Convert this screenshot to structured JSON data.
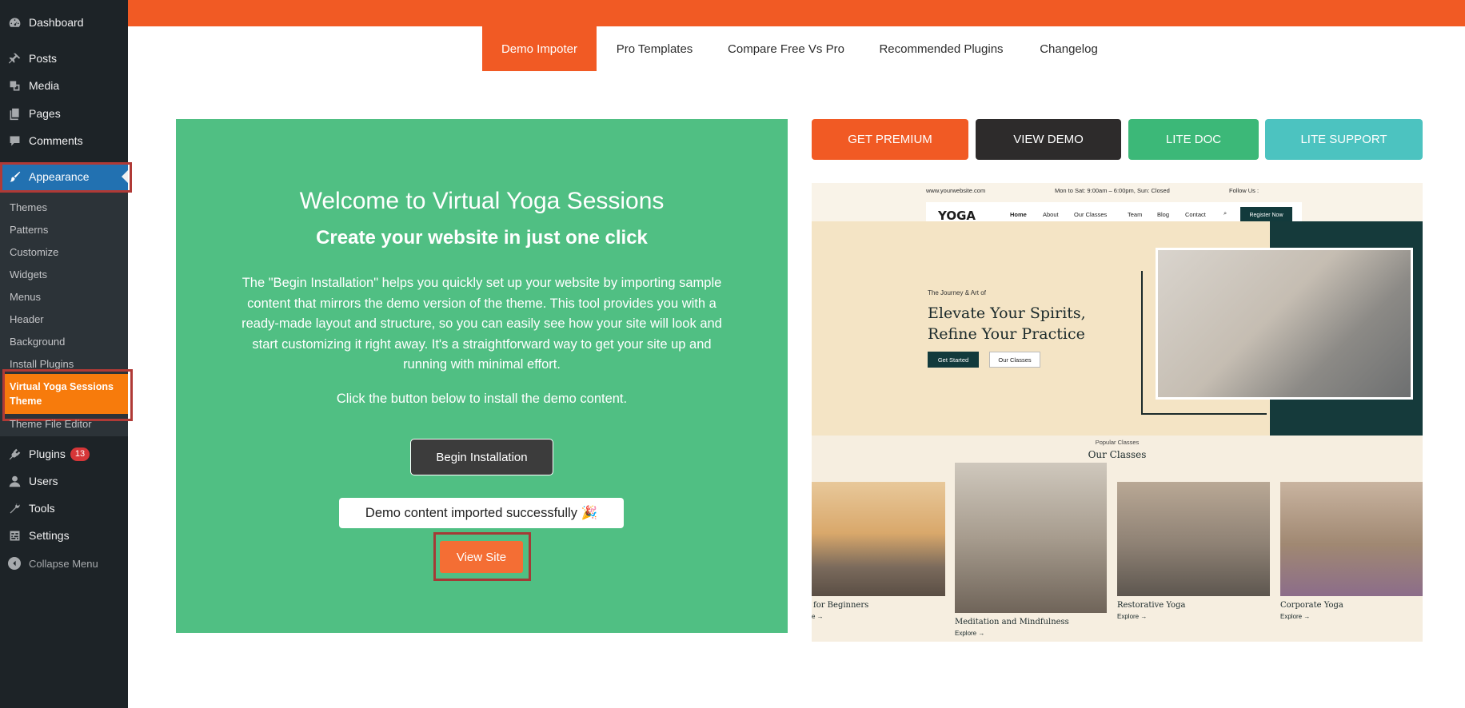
{
  "sidebar": {
    "items": [
      {
        "label": "Dashboard",
        "icon": "dashboard-icon"
      },
      {
        "label": "Posts",
        "icon": "pin-icon"
      },
      {
        "label": "Media",
        "icon": "media-icon"
      },
      {
        "label": "Pages",
        "icon": "pages-icon"
      },
      {
        "label": "Comments",
        "icon": "comment-icon"
      },
      {
        "label": "Appearance",
        "icon": "brush-icon"
      },
      {
        "label": "Plugins",
        "icon": "plugin-icon",
        "badge": "13"
      },
      {
        "label": "Users",
        "icon": "user-icon"
      },
      {
        "label": "Tools",
        "icon": "wrench-icon"
      },
      {
        "label": "Settings",
        "icon": "settings-icon"
      }
    ],
    "submenu": [
      "Themes",
      "Patterns",
      "Customize",
      "Widgets",
      "Menus",
      "Header",
      "Background",
      "Install Plugins",
      "Virtual Yoga Sessions Theme",
      "Theme File Editor"
    ],
    "collapse_label": "Collapse Menu"
  },
  "tabs": [
    "Demo Impoter",
    "Pro Templates",
    "Compare Free Vs Pro",
    "Recommended Plugins",
    "Changelog"
  ],
  "card": {
    "welcome": "Welcome to Virtual Yoga Sessions",
    "headline": "Create your website in just one click",
    "description": "The \"Begin Installation\" helps you quickly set up your website by importing sample content that mirrors the demo version of the theme. This tool provides you with a ready-made layout and structure, so you can easily see how your site will look and start customizing it right away. It's a straightforward way to get your site up and running with minimal effort.",
    "click_note": "Click the button below to install the demo content.",
    "begin_label": "Begin Installation",
    "success_msg": "Demo content imported successfully 🎉",
    "view_site_label": "View Site"
  },
  "actions": [
    "GET PREMIUM",
    "VIEW DEMO",
    "LITE DOC",
    "LITE SUPPORT"
  ],
  "colors": {
    "accent_orange": "#f15a24",
    "green": "#50bf83",
    "dark": "#2d2d2d",
    "doc_green": "#3cb878",
    "support_teal": "#4cc3c0",
    "wp_blue": "#2271b1",
    "highlight_red": "#b03a36"
  },
  "preview": {
    "site_url": "www.yourwebsite.com",
    "hours": "Mon to Sat: 9:00am – 6:00pm, Sun: Closed",
    "follow": "Follow Us :",
    "logo": "YOGA",
    "nav": [
      "Home",
      "About",
      "Our Classes",
      "Team",
      "Blog",
      "Contact"
    ],
    "register": "Register Now",
    "kicker": "The Journey & Art of",
    "title_line1": "Elevate Your Spirits,",
    "title_line2": "Refine Your Practice",
    "btn_started": "Get Started",
    "btn_classes": "Our Classes",
    "popular": "Popular Classes",
    "our_classes": "Our Classes",
    "classes": [
      {
        "title": "for Beginners",
        "explore": "e →"
      },
      {
        "title": "Meditation and Mindfulness",
        "explore": "Explore →"
      },
      {
        "title": "Restorative Yoga",
        "explore": "Explore →"
      },
      {
        "title": "Corporate Yoga",
        "explore": "Explore →"
      }
    ]
  }
}
